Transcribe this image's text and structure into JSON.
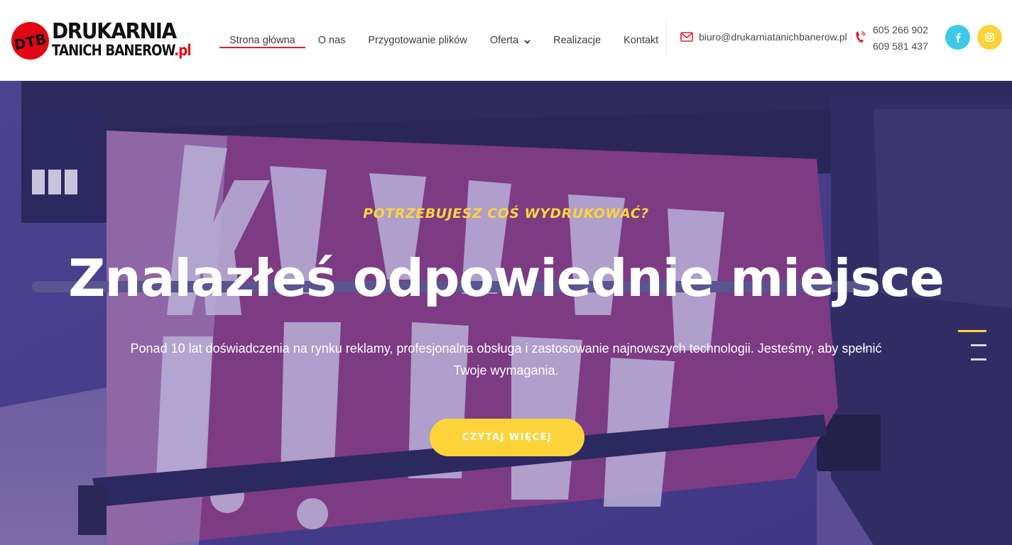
{
  "brand": {
    "badge_text": "DTB",
    "name_line1": "DRUKARNIA",
    "name_line2": "TANICH BANEROW",
    "name_tld": ".pl",
    "red": "#e30613"
  },
  "nav": {
    "items": [
      {
        "label": "Strona główna",
        "active": true
      },
      {
        "label": "O nas"
      },
      {
        "label": "Przygotowanie plików"
      },
      {
        "label": "Oferta",
        "has_dropdown": true
      },
      {
        "label": "Realizacje"
      },
      {
        "label": "Kontakt"
      }
    ],
    "active_color": "#e31e24"
  },
  "contact": {
    "email": "biuro@drukarniatanichbanerow.pl",
    "email_icon": "envelope-icon",
    "phone_icon": "phone-icon",
    "phones": [
      "605 266 902",
      "609 581 437"
    ]
  },
  "social": [
    {
      "name": "facebook",
      "icon": "facebook-icon",
      "color": "#40c9e6"
    },
    {
      "name": "instagram",
      "icon": "instagram-icon",
      "color": "#fcd43a"
    }
  ],
  "hero": {
    "tagline": "POTRZEBUJESZ COŚ WYDRUKOWAĆ?",
    "headline": "Znalazłeś odpowiednie miejsce",
    "subtitle": "Ponad 10 lat doświadczenia na rynku reklamy, profesjonalna obsługa i zastosowanie najnowszych technologii. Jesteśmy, aby spełnić Twoje wymagania.",
    "cta_label": "CZYTAJ WIĘCEJ",
    "accent": "#fcd43a",
    "slides_count": 3,
    "active_slide": 1
  }
}
